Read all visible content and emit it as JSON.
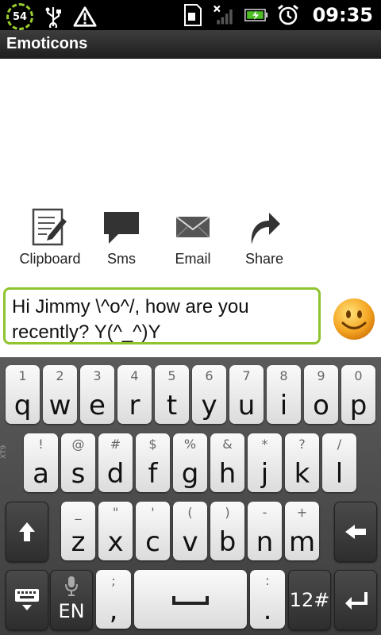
{
  "status": {
    "battery_level": "54",
    "time": "09:35"
  },
  "title": "Emoticons",
  "actions": [
    {
      "label": "Clipboard",
      "icon": "clipboard-icon"
    },
    {
      "label": "Sms",
      "icon": "sms-icon"
    },
    {
      "label": "Email",
      "icon": "email-icon"
    },
    {
      "label": "Share",
      "icon": "share-icon"
    }
  ],
  "message": {
    "value": "Hi Jimmy \\^o^/, how are you recently? Y(^_^)Y"
  },
  "keyboard": {
    "row1": [
      {
        "alt": "1",
        "char": "q"
      },
      {
        "alt": "2",
        "char": "w"
      },
      {
        "alt": "3",
        "char": "e"
      },
      {
        "alt": "4",
        "char": "r"
      },
      {
        "alt": "5",
        "char": "t"
      },
      {
        "alt": "6",
        "char": "y"
      },
      {
        "alt": "7",
        "char": "u"
      },
      {
        "alt": "8",
        "char": "i"
      },
      {
        "alt": "9",
        "char": "o"
      },
      {
        "alt": "0",
        "char": "p"
      }
    ],
    "row2": [
      {
        "alt": "!",
        "char": "a"
      },
      {
        "alt": "@",
        "char": "s"
      },
      {
        "alt": "#",
        "char": "d"
      },
      {
        "alt": "$",
        "char": "f"
      },
      {
        "alt": "%",
        "char": "g"
      },
      {
        "alt": "&",
        "char": "h"
      },
      {
        "alt": "*",
        "char": "j"
      },
      {
        "alt": "?",
        "char": "k"
      },
      {
        "alt": "/",
        "char": "l"
      }
    ],
    "row3": [
      {
        "alt": "_",
        "char": "z"
      },
      {
        "alt": "\"",
        "char": "x"
      },
      {
        "alt": "'",
        "char": "c"
      },
      {
        "alt": "(",
        "char": "v"
      },
      {
        "alt": ")",
        "char": "b"
      },
      {
        "alt": "-",
        "char": "n"
      },
      {
        "alt": "+",
        "char": "m"
      }
    ],
    "side_label": "XT9",
    "lang": "EN",
    "punct_alt": ";",
    "punct_char": ",",
    "dot_alt": ":",
    "dot_char": ".",
    "symbols": "12#"
  }
}
